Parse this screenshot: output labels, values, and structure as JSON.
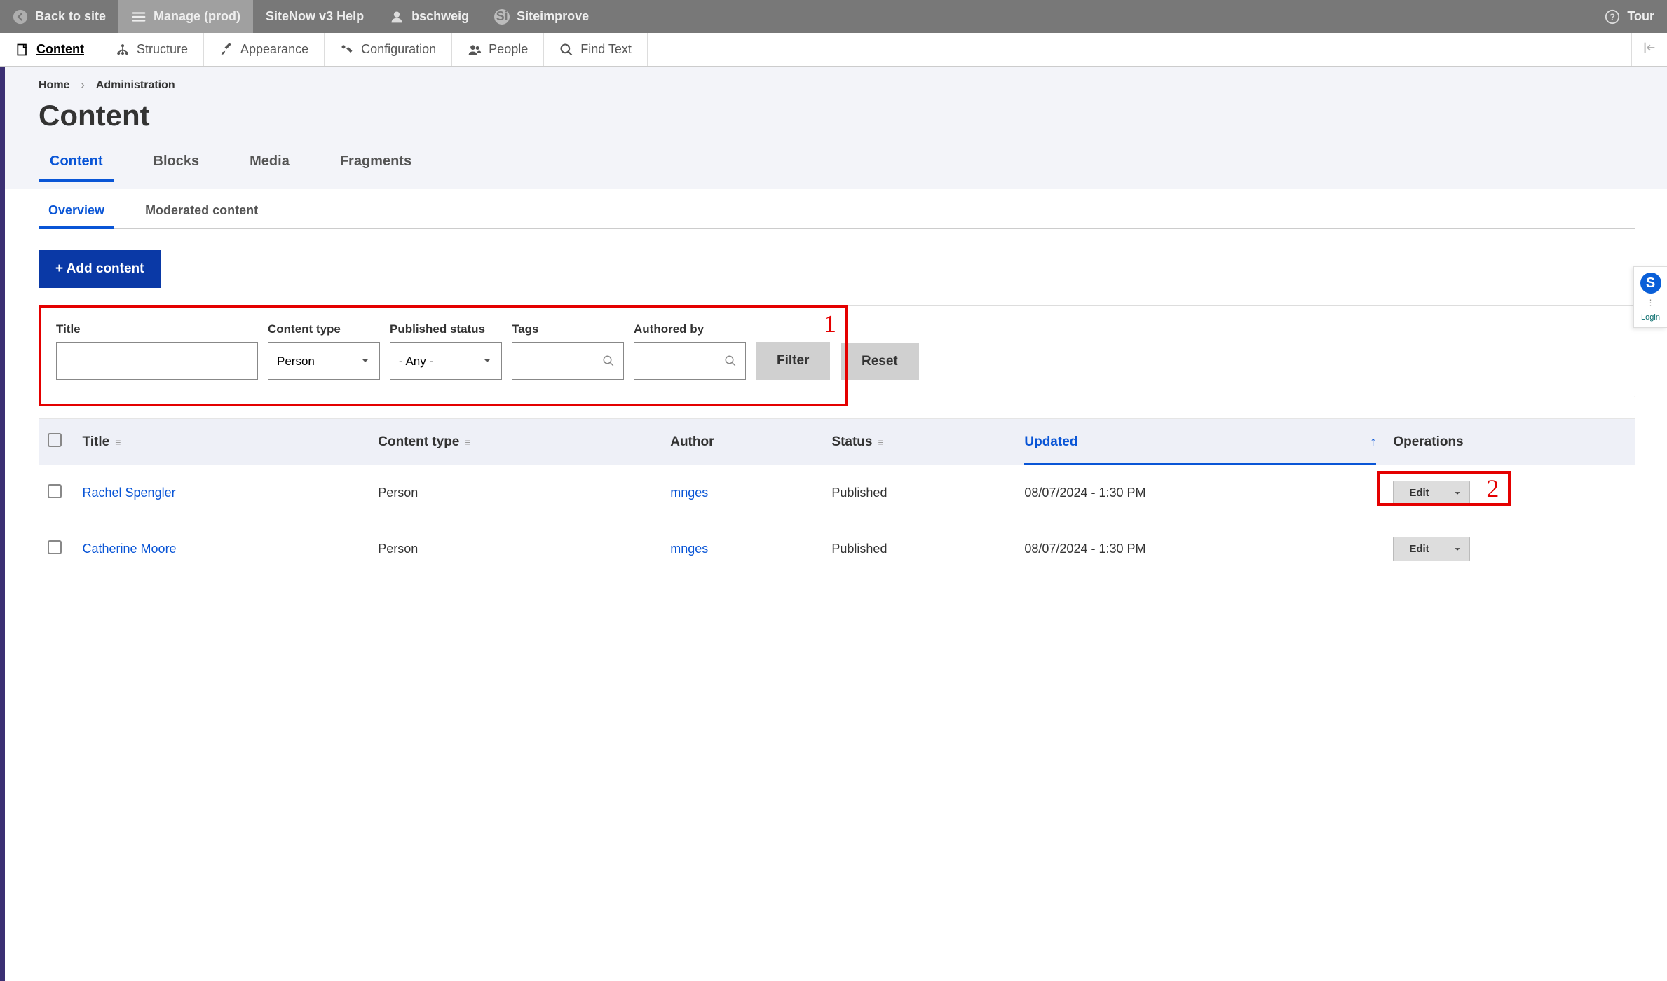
{
  "toolbar": {
    "back": "Back to site",
    "manage": "Manage (prod)",
    "help": "SiteNow v3 Help",
    "user": "bschweig",
    "siteimprove": "Siteimprove",
    "siteimprove_badge": "Si",
    "tour": "Tour"
  },
  "admin_menu": {
    "content": "Content",
    "structure": "Structure",
    "appearance": "Appearance",
    "configuration": "Configuration",
    "people": "People",
    "find_text": "Find Text"
  },
  "breadcrumb": {
    "home": "Home",
    "admin": "Administration"
  },
  "page_title": "Content",
  "tabs": {
    "content": "Content",
    "blocks": "Blocks",
    "media": "Media",
    "fragments": "Fragments"
  },
  "subtabs": {
    "overview": "Overview",
    "moderated": "Moderated content"
  },
  "add_content": "+ Add content",
  "filters": {
    "title_label": "Title",
    "ctype_label": "Content type",
    "ctype_value": "Person",
    "status_label": "Published status",
    "status_value": "- Any -",
    "tags_label": "Tags",
    "authored_label": "Authored by",
    "filter_btn": "Filter",
    "reset_btn": "Reset"
  },
  "table": {
    "headers": {
      "title": "Title",
      "ctype": "Content type",
      "author": "Author",
      "status": "Status",
      "updated": "Updated",
      "ops": "Operations"
    },
    "sort_col": "updated",
    "sort_dir": "asc",
    "rows": [
      {
        "title": "Rachel Spengler",
        "ctype": "Person",
        "author": "mnges",
        "status": "Published",
        "updated": "08/07/2024 - 1:30 PM",
        "op": "Edit"
      },
      {
        "title": "Catherine Moore",
        "ctype": "Person",
        "author": "mnges",
        "status": "Published",
        "updated": "08/07/2024 - 1:30 PM",
        "op": "Edit"
      }
    ]
  },
  "annotations": {
    "one": "1",
    "two": "2"
  },
  "side": {
    "logo": "S",
    "login": "Login"
  }
}
